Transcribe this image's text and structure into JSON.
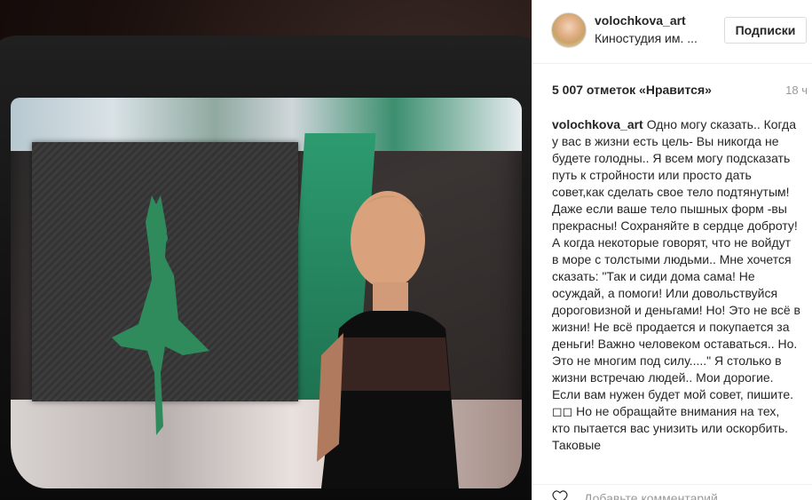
{
  "post": {
    "username": "volochkova_art",
    "location": "Киностудия им. ...",
    "follow_label": "Подписки",
    "likes": "5 007 отметок «Нравится»",
    "time": "18 ч",
    "caption_author": "volochkova_art",
    "caption_text": "Одно могу сказать.. Когда у вас в жизни есть цель- Вы никогда не будете голодны.. Я всем могу подсказать путь к стройности или просто дать совет,как сделать свое тело подтянутым! Даже если ваше тело пышных форм -вы прекрасны! Сохраняйте в сердце доброту! А когда некоторые говорят, что не войдут в море с толстыми людьми.. Мне хочется сказать: \"Так и сиди дома сама! Не осуждай, а помоги! Или довольствуйся дороговизной и деньгами! Но! Это не всё в жизни! Не всё продается и покупается за деньги! Важно человеком оставаться.. Но. Это не многим под силу.....\" Я столько в жизни встречаю людей.. Мои дорогие. Если вам нужен будет мой совет, пишите. ◻◻ Но не обращайте внимания на тех, кто пытается вас унизить или оскорбить. Таковые",
    "comment_placeholder": "Добавьте комментарий..."
  },
  "icons": {
    "like": "heart-icon",
    "avatar": "avatar"
  },
  "colors": {
    "text": "#262626",
    "muted": "#999999",
    "border": "#dbdbdb"
  }
}
